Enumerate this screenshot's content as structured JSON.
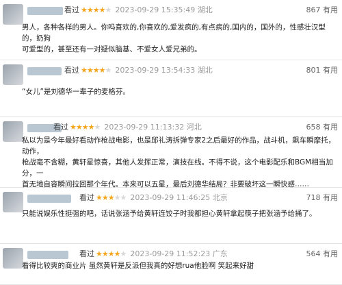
{
  "reviews": [
    {
      "watched_label": "看过",
      "stars": 4,
      "time": "2023-09-29 15:35:49",
      "location": "湖北",
      "useful_count": "867",
      "useful_label": "有用",
      "lines": [
        "男人，各种各样的男人。你吗喜欢的,你喜欢的,爱发疯的,有点病的,国内的，国外的，性感壮汉型的，奶狗",
        "可爱型的，甚至还有一对疑似脑基、不爱女人爱兄弟的。"
      ]
    },
    {
      "watched_label": "看过",
      "stars": 4,
      "time": "2023-09-29 13:54:33",
      "location": "湖北",
      "useful_count": "801",
      "useful_label": "有用",
      "lines": [
        "“女儿”是刘德华一辈子的麦格芬。"
      ]
    },
    {
      "watched_label": "看过",
      "stars": 4,
      "time": "2023-09-29 11:13:32",
      "location": "河北",
      "useful_count": "658",
      "useful_label": "有用",
      "lines": [
        "私以为是今年最好看动作枪战电影，也是邱礼涛拆弹专家2之后最好的作品，战斗机，飙车瞬摩托，动作，",
        "枪战毫不含糊，黄轩星惊喜，其他人发挥正常，演技在线。不得不说，这个电影配乐和BGM相当加分，一",
        "首无地自容瞬间拉回那个年代。本来可以五星，最后刘德华结局？非要破坏这一瞬快感……"
      ]
    },
    {
      "watched_label": "看过",
      "stars": 3,
      "time": "2023-09-29 11:46:25",
      "location": "北京",
      "useful_count": "718",
      "useful_label": "有用",
      "lines": [
        "只能说娱乐性挺强的吧，话说张涵予给黄轩连饺子时我都担心黄轩拿起筷子把张涵予给捅了。"
      ]
    },
    {
      "watched_label": "看过",
      "stars": 4,
      "time": "2023-09-29 11:52:23",
      "location": "广东",
      "useful_count": "564",
      "useful_label": "有用",
      "lines": [
        "看得比较爽的商业片 虽然黄轩是反派但我真的好想rua他脸啊 笑起来好甜"
      ]
    }
  ]
}
